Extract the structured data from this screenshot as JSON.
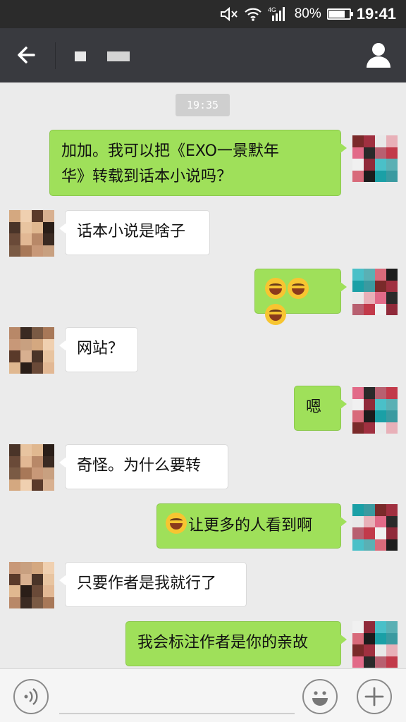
{
  "status_bar": {
    "battery_percent_text": "80%",
    "battery_level": 0.8,
    "time": "19:41",
    "icons": [
      "mute-icon",
      "wifi-icon",
      "4g-signal-icon",
      "battery-icon"
    ]
  },
  "header": {
    "back_icon": "arrow-left-icon",
    "profile_icon": "person-icon"
  },
  "chat": {
    "timestamp": "19:35",
    "messages": [
      {
        "from": "me",
        "text_line1": "加加。我可以把《EXO一景默年",
        "text_line2": "华》转载到话本小说吗？"
      },
      {
        "from": "them",
        "text": "话本小说是啥子"
      },
      {
        "from": "me",
        "emoji": "joy-emoji",
        "emoji_count": 3
      },
      {
        "from": "them",
        "text": "网站？"
      },
      {
        "from": "me",
        "text": "嗯"
      },
      {
        "from": "them",
        "text": "奇怪。为什么要转"
      },
      {
        "from": "me",
        "emoji": "joy-emoji",
        "text": "让更多的人看到啊"
      },
      {
        "from": "them",
        "text": "只要作者是我就行了"
      },
      {
        "from": "me",
        "text": "我会标注作者是你的亲故"
      }
    ]
  },
  "input_bar": {
    "voice_icon": "voice-icon",
    "emoji_icon": "smiley-icon",
    "plus_icon": "plus-icon",
    "input_value": ""
  },
  "colors": {
    "header_bg": "#393a3f",
    "status_bg": "#2b2b2b",
    "chat_bg": "#ebebeb",
    "my_bubble": "#9fe05a",
    "their_bubble": "#ffffff"
  }
}
